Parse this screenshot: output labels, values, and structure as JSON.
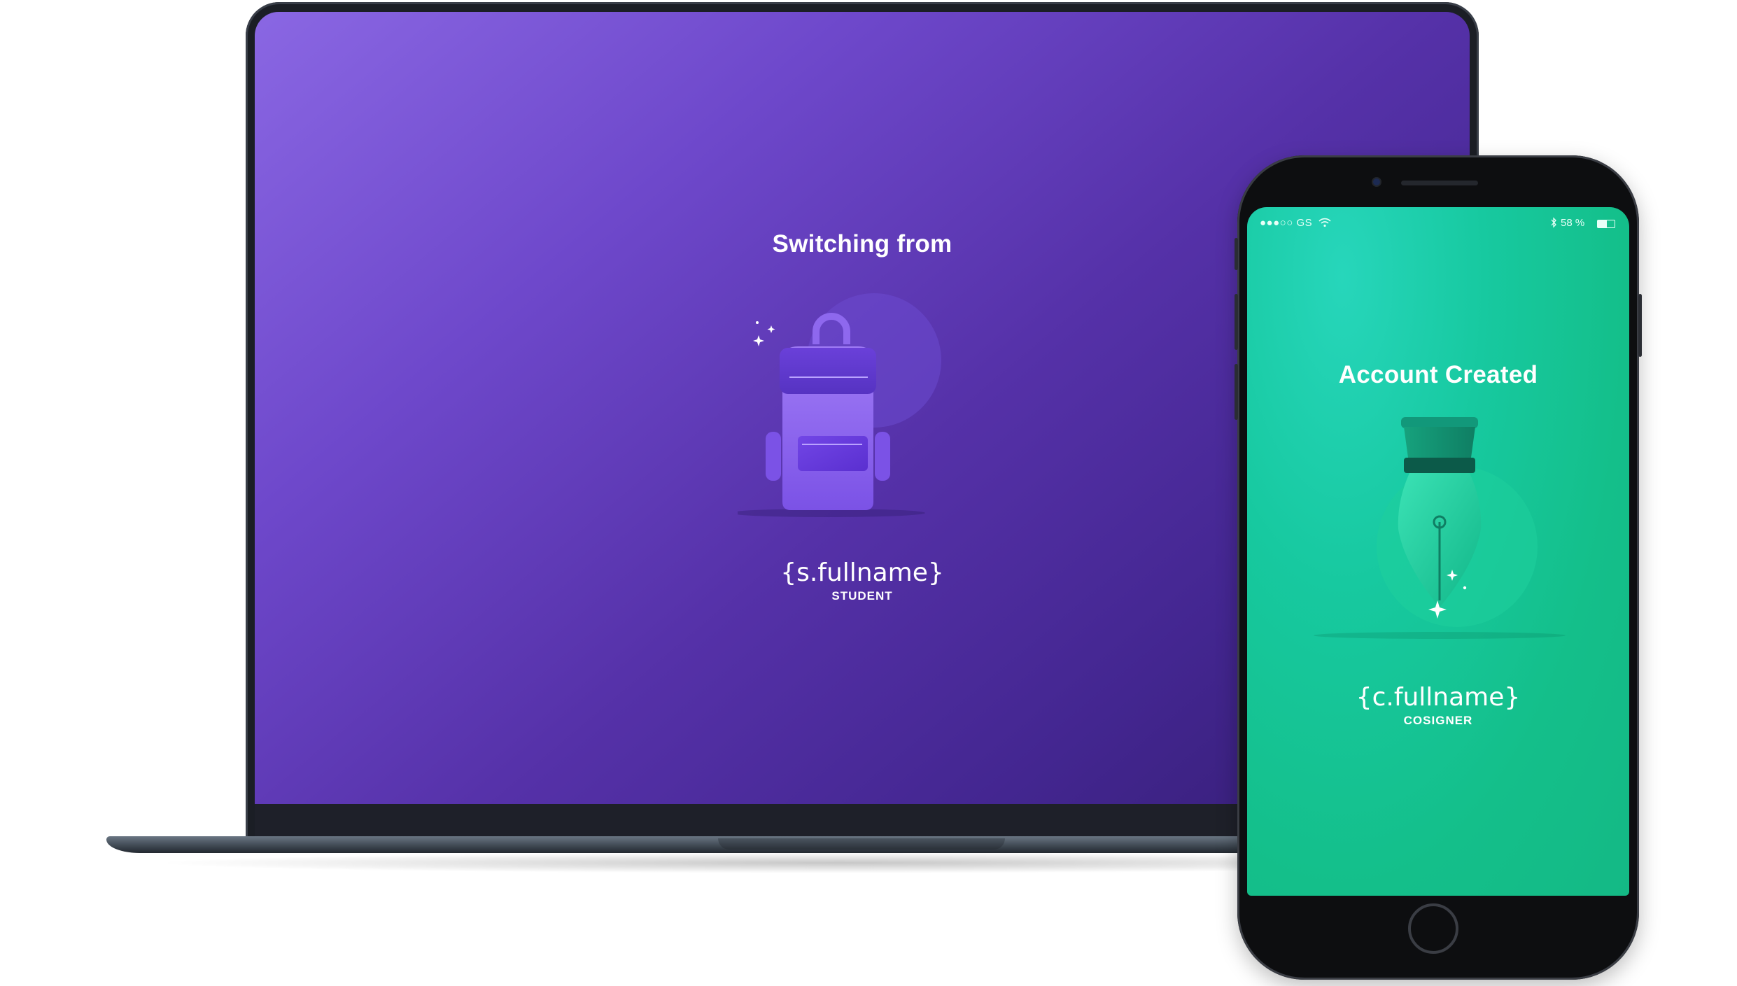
{
  "laptop": {
    "title": "Switching from",
    "name": "{s.fullname}",
    "role": "STUDENT",
    "colors": {
      "screen_start": "#8a67e3",
      "screen_end": "#341d72",
      "backpack": "#9a6cf4"
    }
  },
  "phone": {
    "status": {
      "carrier": "●●●○○ GS",
      "battery": "58 %"
    },
    "title": "Account Created",
    "name": "{c.fullname}",
    "role": "COSIGNER",
    "colors": {
      "screen": "#14bf8a",
      "pen": "#2fd7a9"
    }
  }
}
